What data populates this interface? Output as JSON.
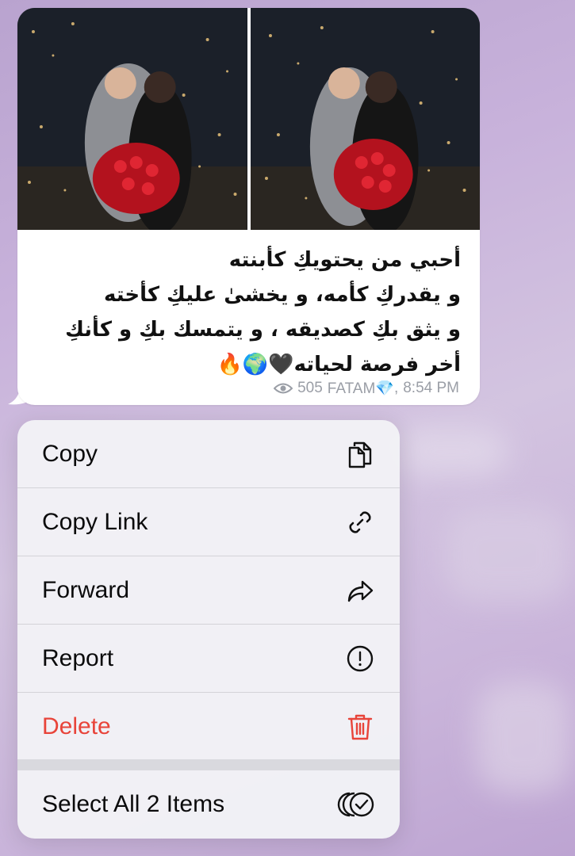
{
  "message": {
    "lines": [
      "أحبي من يحتويكِ كأبنته",
      "و يقدركِ كأمه، و يخشىٰ عليكِ كأخته",
      "و يثق بكِ كصديقه ، و يتمسك بكِ  و كأنكِ",
      "أخر فرصة لحياته🖤🌍🔥"
    ],
    "views": "505",
    "author": "FATAM💎",
    "time": "8:54 PM"
  },
  "menu": {
    "items": [
      {
        "label": "Copy",
        "icon": "copy-icon"
      },
      {
        "label": "Copy Link",
        "icon": "link-icon"
      },
      {
        "label": "Forward",
        "icon": "forward-icon"
      },
      {
        "label": "Report",
        "icon": "report-icon"
      },
      {
        "label": "Delete",
        "icon": "trash-icon",
        "color": "#e8443a"
      },
      {
        "label": "Select All 2 Items",
        "icon": "select-all-icon"
      }
    ]
  }
}
